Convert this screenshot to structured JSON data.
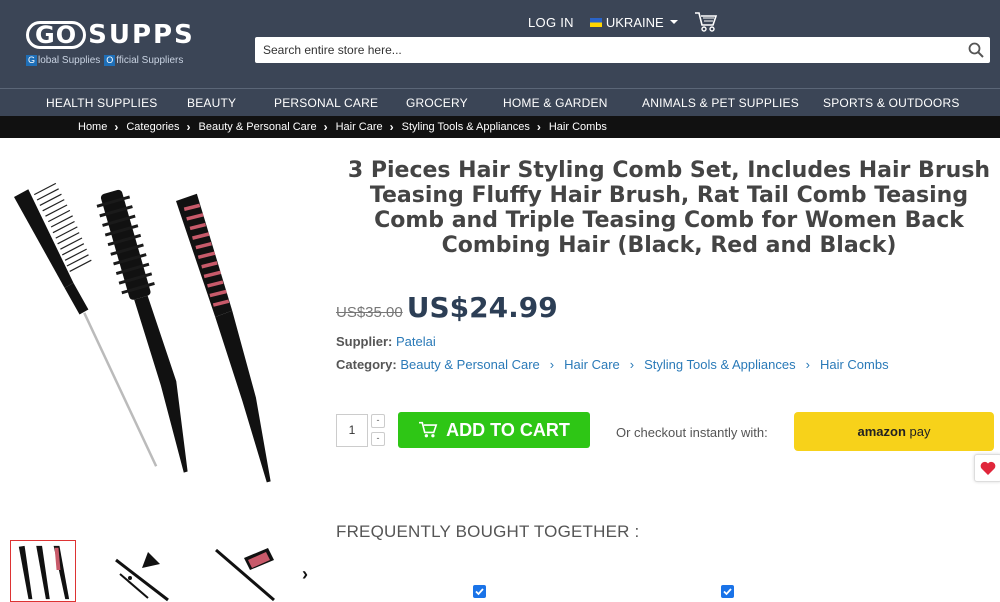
{
  "brand": {
    "logo_go": "GO",
    "logo_supps": "SUPPS",
    "tagline_g": "G",
    "tagline_1": "lobal Supplies",
    "tagline_o": "O",
    "tagline_2": "fficial Suppliers"
  },
  "header": {
    "login": "LOG IN",
    "country": "UKRAINE",
    "search_placeholder": "Search entire store here..."
  },
  "nav": [
    "HEALTH SUPPLIES",
    "BEAUTY",
    "PERSONAL CARE",
    "GROCERY",
    "HOME & GARDEN",
    "ANIMALS & PET SUPPLIES",
    "SPORTS & OUTDOORS"
  ],
  "breadcrumb": [
    "Home",
    "Categories",
    "Beauty & Personal Care",
    "Hair Care",
    "Styling Tools & Appliances",
    "Hair Combs"
  ],
  "product": {
    "title": "3 Pieces Hair Styling Comb Set, Includes Hair Brush Teasing Fluffy Hair Brush, Rat Tail Comb Teasing Comb and Triple Teasing Comb for Women Back Combing Hair (Black, Red and Black)",
    "old_price": "US$35.00",
    "price": "US$24.99",
    "supplier_label": "Supplier:",
    "supplier": "Patelai",
    "category_label": "Category:",
    "categories": [
      "Beauty & Personal Care",
      "Hair Care",
      "Styling Tools & Appliances",
      "Hair Combs"
    ],
    "quantity": "1",
    "qty_up": "-",
    "qty_down": "-",
    "add_to_cart": "ADD TO CART",
    "checkout_text": "Or checkout instantly with:",
    "amazon_pay_a": "amazon",
    "amazon_pay_b": "pay"
  },
  "fbt_title": "FREQUENTLY BOUGHT TOGETHER :",
  "colors": {
    "header_bg": "#3b4556",
    "crumb_bg": "#111111",
    "add_to_cart_bg": "#2ec615",
    "amazon_pay_bg": "#f7d21a",
    "link": "#2a7ab8"
  }
}
